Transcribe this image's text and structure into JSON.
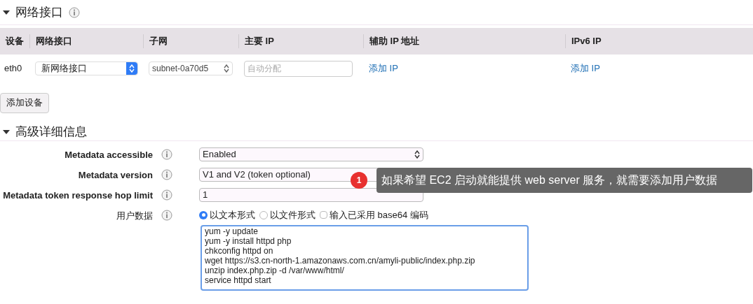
{
  "network_section": {
    "title": "网络接口",
    "expanded": true,
    "table": {
      "columns": [
        "设备",
        "网络接口",
        "子网",
        "主要 IP",
        "辅助 IP 地址",
        "IPv6 IP"
      ],
      "rows": [
        {
          "device": "eth0",
          "interface": "新网络接口",
          "subnet": "subnet-0a70d5",
          "primary_ip_placeholder": "自动分配",
          "secondary_ip_link": "添加 IP",
          "ipv6_link": "添加 IP"
        }
      ]
    },
    "add_button": "添加设备"
  },
  "advanced_section": {
    "title": "高级详细信息",
    "expanded": true,
    "fields": [
      {
        "kind": "select",
        "label": "Metadata accessible",
        "value": "Enabled"
      },
      {
        "kind": "covered_select",
        "label": "Metadata version",
        "value": "V1 and V2 (token optional)"
      },
      {
        "kind": "input",
        "label": "Metadata token response hop limit",
        "value": "1"
      },
      {
        "kind": "radios",
        "label": "用户数据",
        "options": [
          {
            "label": "以文本形式",
            "selected": true
          },
          {
            "label": "以文件形式",
            "selected": false
          }
        ],
        "checkbox": {
          "label": "输入已采用 base64 编码",
          "checked": false
        }
      }
    ],
    "user_data": "yum -y update\nyum -y install httpd php\nchkconfig httpd on\nwget https://s3.cn-north-1.amazonaws.com.cn/amyli-public/index.php.zip\nunzip index.php.zip -d /var/www/html/\nservice httpd start"
  },
  "callout": {
    "number": "1",
    "text": "如果希望 EC2 启动就能提供 web server 服务，就需要添加用户数据"
  }
}
